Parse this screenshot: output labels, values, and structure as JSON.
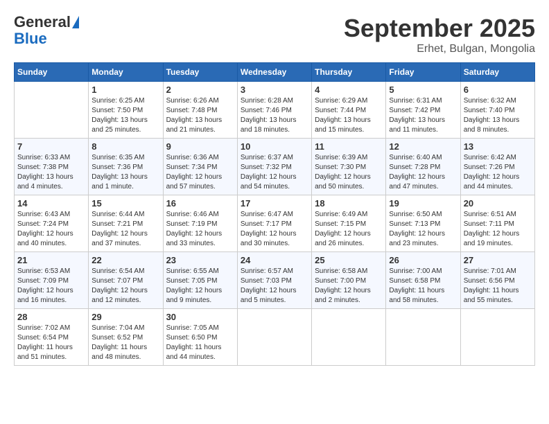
{
  "logo": {
    "general": "General",
    "blue": "Blue"
  },
  "title": "September 2025",
  "location": "Erhet, Bulgan, Mongolia",
  "days_header": [
    "Sunday",
    "Monday",
    "Tuesday",
    "Wednesday",
    "Thursday",
    "Friday",
    "Saturday"
  ],
  "weeks": [
    [
      {
        "day": "",
        "info": ""
      },
      {
        "day": "1",
        "info": "Sunrise: 6:25 AM\nSunset: 7:50 PM\nDaylight: 13 hours\nand 25 minutes."
      },
      {
        "day": "2",
        "info": "Sunrise: 6:26 AM\nSunset: 7:48 PM\nDaylight: 13 hours\nand 21 minutes."
      },
      {
        "day": "3",
        "info": "Sunrise: 6:28 AM\nSunset: 7:46 PM\nDaylight: 13 hours\nand 18 minutes."
      },
      {
        "day": "4",
        "info": "Sunrise: 6:29 AM\nSunset: 7:44 PM\nDaylight: 13 hours\nand 15 minutes."
      },
      {
        "day": "5",
        "info": "Sunrise: 6:31 AM\nSunset: 7:42 PM\nDaylight: 13 hours\nand 11 minutes."
      },
      {
        "day": "6",
        "info": "Sunrise: 6:32 AM\nSunset: 7:40 PM\nDaylight: 13 hours\nand 8 minutes."
      }
    ],
    [
      {
        "day": "7",
        "info": "Sunrise: 6:33 AM\nSunset: 7:38 PM\nDaylight: 13 hours\nand 4 minutes."
      },
      {
        "day": "8",
        "info": "Sunrise: 6:35 AM\nSunset: 7:36 PM\nDaylight: 13 hours\nand 1 minute."
      },
      {
        "day": "9",
        "info": "Sunrise: 6:36 AM\nSunset: 7:34 PM\nDaylight: 12 hours\nand 57 minutes."
      },
      {
        "day": "10",
        "info": "Sunrise: 6:37 AM\nSunset: 7:32 PM\nDaylight: 12 hours\nand 54 minutes."
      },
      {
        "day": "11",
        "info": "Sunrise: 6:39 AM\nSunset: 7:30 PM\nDaylight: 12 hours\nand 50 minutes."
      },
      {
        "day": "12",
        "info": "Sunrise: 6:40 AM\nSunset: 7:28 PM\nDaylight: 12 hours\nand 47 minutes."
      },
      {
        "day": "13",
        "info": "Sunrise: 6:42 AM\nSunset: 7:26 PM\nDaylight: 12 hours\nand 44 minutes."
      }
    ],
    [
      {
        "day": "14",
        "info": "Sunrise: 6:43 AM\nSunset: 7:24 PM\nDaylight: 12 hours\nand 40 minutes."
      },
      {
        "day": "15",
        "info": "Sunrise: 6:44 AM\nSunset: 7:21 PM\nDaylight: 12 hours\nand 37 minutes."
      },
      {
        "day": "16",
        "info": "Sunrise: 6:46 AM\nSunset: 7:19 PM\nDaylight: 12 hours\nand 33 minutes."
      },
      {
        "day": "17",
        "info": "Sunrise: 6:47 AM\nSunset: 7:17 PM\nDaylight: 12 hours\nand 30 minutes."
      },
      {
        "day": "18",
        "info": "Sunrise: 6:49 AM\nSunset: 7:15 PM\nDaylight: 12 hours\nand 26 minutes."
      },
      {
        "day": "19",
        "info": "Sunrise: 6:50 AM\nSunset: 7:13 PM\nDaylight: 12 hours\nand 23 minutes."
      },
      {
        "day": "20",
        "info": "Sunrise: 6:51 AM\nSunset: 7:11 PM\nDaylight: 12 hours\nand 19 minutes."
      }
    ],
    [
      {
        "day": "21",
        "info": "Sunrise: 6:53 AM\nSunset: 7:09 PM\nDaylight: 12 hours\nand 16 minutes."
      },
      {
        "day": "22",
        "info": "Sunrise: 6:54 AM\nSunset: 7:07 PM\nDaylight: 12 hours\nand 12 minutes."
      },
      {
        "day": "23",
        "info": "Sunrise: 6:55 AM\nSunset: 7:05 PM\nDaylight: 12 hours\nand 9 minutes."
      },
      {
        "day": "24",
        "info": "Sunrise: 6:57 AM\nSunset: 7:03 PM\nDaylight: 12 hours\nand 5 minutes."
      },
      {
        "day": "25",
        "info": "Sunrise: 6:58 AM\nSunset: 7:00 PM\nDaylight: 12 hours\nand 2 minutes."
      },
      {
        "day": "26",
        "info": "Sunrise: 7:00 AM\nSunset: 6:58 PM\nDaylight: 11 hours\nand 58 minutes."
      },
      {
        "day": "27",
        "info": "Sunrise: 7:01 AM\nSunset: 6:56 PM\nDaylight: 11 hours\nand 55 minutes."
      }
    ],
    [
      {
        "day": "28",
        "info": "Sunrise: 7:02 AM\nSunset: 6:54 PM\nDaylight: 11 hours\nand 51 minutes."
      },
      {
        "day": "29",
        "info": "Sunrise: 7:04 AM\nSunset: 6:52 PM\nDaylight: 11 hours\nand 48 minutes."
      },
      {
        "day": "30",
        "info": "Sunrise: 7:05 AM\nSunset: 6:50 PM\nDaylight: 11 hours\nand 44 minutes."
      },
      {
        "day": "",
        "info": ""
      },
      {
        "day": "",
        "info": ""
      },
      {
        "day": "",
        "info": ""
      },
      {
        "day": "",
        "info": ""
      }
    ]
  ]
}
